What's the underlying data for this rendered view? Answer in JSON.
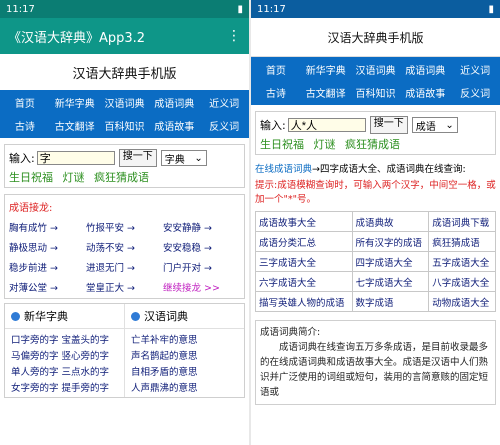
{
  "left": {
    "status_time": "11:17",
    "app_title": "《汉语大辞典》App3.2",
    "site_title": "汉语大辞典手机版",
    "nav_row1": [
      "首页",
      "新华字典",
      "汉语词典",
      "成语词典",
      "近义词"
    ],
    "nav_row2": [
      "古诗",
      "古文翻译",
      "百科知识",
      "成语故事",
      "反义词"
    ],
    "search": {
      "label": "输入:",
      "value": "字",
      "button": "搜一下",
      "select": "字典"
    },
    "quick": [
      "生日祝福",
      "灯谜",
      "疯狂猜成语"
    ],
    "jielong": {
      "title": "成语接龙:",
      "items": [
        "胸有成竹 →",
        "竹报平安 →",
        "安安静静 →",
        "静极思动 →",
        "动荡不安 →",
        "安安稳稳 →",
        "稳步前进 →",
        "进退无门 →",
        "门户开对 →",
        "对薄公堂 →",
        "堂皇正大 →",
        "继续接龙 >>"
      ]
    },
    "xinhua": {
      "title": "新华字典",
      "items": [
        "口字旁的字",
        "宝盖头的字",
        "马偏旁的字",
        "竖心旁的字",
        "单人旁的字",
        "三点水的字",
        "女字旁的字",
        "提手旁的字"
      ]
    },
    "cidian": {
      "title": "汉语词典",
      "items": [
        "亡羊补牢的意思",
        "声名鹊起的意思",
        "自相矛盾的意思",
        "人声鼎沸的意思"
      ]
    }
  },
  "right": {
    "status_time": "11:17",
    "page_title": "汉语大辞典手机版",
    "nav_row1": [
      "首页",
      "新华字典",
      "汉语词典",
      "成语词典",
      "近义词"
    ],
    "nav_row2": [
      "古诗",
      "古文翻译",
      "百科知识",
      "成语故事",
      "反义词"
    ],
    "search": {
      "label": "输入:",
      "value": "人*人",
      "button": "搜一下",
      "select": "成语"
    },
    "quick": [
      "生日祝福",
      "灯谜",
      "疯狂猜成语"
    ],
    "result_link": "在线成语词典",
    "result_text": "→四字成语大全、成语词典在线查询:",
    "tip": "提示:成语模糊查询时，可输入两个汉字，中间空一格，或加一个\"*\"号。",
    "table": [
      [
        "成语故事大全",
        "成语典故",
        "成语词典下载"
      ],
      [
        "成语分类汇总",
        "所有汉字的成语",
        "疯狂猜成语"
      ],
      [
        "三字成语大全",
        "四字成语大全",
        "五字成语大全"
      ],
      [
        "六字成语大全",
        "七字成语大全",
        "八字成语大全"
      ],
      [
        "描写英雄人物的成语",
        "数字成语",
        "动物成语大全"
      ]
    ],
    "intro_title": "成语词典简介:",
    "intro_text": "成语词典在线查询五万多条成语，是目前收录最多的在线成语词典和成语故事大全。成语是汉语中人们熟识并广泛使用的词组或短句，装用的言简意赅的固定短语或"
  }
}
